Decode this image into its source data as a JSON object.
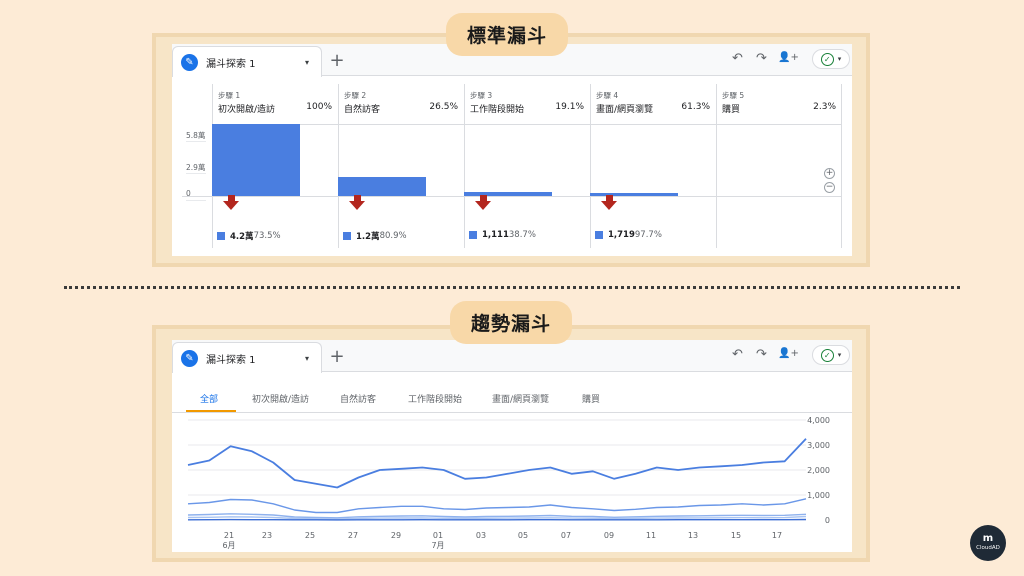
{
  "sections": {
    "standard_title": "標準漏斗",
    "trend_title": "趨勢漏斗"
  },
  "toolbar": {
    "tab_label": "漏斗探索 1",
    "plus": "+",
    "undo": "↶",
    "redo": "↷",
    "share": "👤+",
    "caret": "▾",
    "check": "✓"
  },
  "funnel": {
    "y_axis": [
      "5.8萬",
      "2.9萬",
      "0"
    ],
    "steps": [
      {
        "num": "步驟 1",
        "name": "初次開啟/造訪",
        "pct": "100%"
      },
      {
        "num": "步驟 2",
        "name": "自然訪客",
        "pct": "26.5%"
      },
      {
        "num": "步驟 3",
        "name": "工作階段開始",
        "pct": "19.1%"
      },
      {
        "num": "步驟 4",
        "name": "畫面/網頁瀏覽",
        "pct": "61.3%"
      },
      {
        "num": "步驟 5",
        "name": "購買",
        "pct": "2.3%"
      }
    ],
    "bar_fractions": [
      1.0,
      0.265,
      0.051,
      0.031,
      0.0
    ],
    "dropoffs": [
      {
        "value": "4.2萬",
        "pct": "73.5%"
      },
      {
        "value": "1.2萬",
        "pct": "80.9%"
      },
      {
        "value": "1,111",
        "pct": "38.7%"
      },
      {
        "value": "1,719",
        "pct": "97.7%"
      }
    ],
    "zoom_in": "+",
    "zoom_out": "−",
    "colors": {
      "bar": "#4a7ee0",
      "drop_arrow": "#b3261e"
    }
  },
  "trend": {
    "tabs": [
      "全部",
      "初次開啟/造訪",
      "自然訪客",
      "工作階段開始",
      "畫面/網頁瀏覽",
      "購買"
    ],
    "active_tab": "全部",
    "chart_data": {
      "type": "line",
      "y_ticks": [
        "4,000",
        "3,000",
        "2,000",
        "1,000",
        "0"
      ],
      "ylim": [
        0,
        4000
      ],
      "x_ticks": [
        {
          "day": "21",
          "month": "6月"
        },
        {
          "day": "23",
          "month": ""
        },
        {
          "day": "25",
          "month": ""
        },
        {
          "day": "27",
          "month": ""
        },
        {
          "day": "29",
          "month": ""
        },
        {
          "day": "01",
          "month": "7月"
        },
        {
          "day": "03",
          "month": ""
        },
        {
          "day": "05",
          "month": ""
        },
        {
          "day": "07",
          "month": ""
        },
        {
          "day": "09",
          "month": ""
        },
        {
          "day": "11",
          "month": ""
        },
        {
          "day": "13",
          "month": ""
        },
        {
          "day": "15",
          "month": ""
        },
        {
          "day": "17",
          "month": ""
        }
      ],
      "series": [
        {
          "values": [
            2200,
            2380,
            2950,
            2750,
            2300,
            1600,
            1450,
            1300,
            1700,
            2000,
            2050,
            2100,
            2000,
            1650,
            1700,
            1850,
            2000,
            2100,
            1850,
            1950,
            1650,
            1850,
            2100,
            2000,
            2100,
            2150,
            2200,
            2300,
            2350,
            3250
          ],
          "color": "#4a7ee0"
        },
        {
          "values": [
            650,
            700,
            820,
            800,
            650,
            400,
            300,
            300,
            450,
            500,
            550,
            550,
            450,
            420,
            480,
            500,
            520,
            600,
            500,
            450,
            380,
            430,
            500,
            520,
            580,
            600,
            650,
            600,
            650,
            850
          ],
          "color": "#6a97e8"
        },
        {
          "values": [
            200,
            220,
            250,
            230,
            200,
            120,
            100,
            90,
            130,
            150,
            160,
            170,
            140,
            120,
            140,
            150,
            160,
            180,
            150,
            140,
            110,
            130,
            150,
            160,
            170,
            180,
            190,
            180,
            190,
            230
          ],
          "color": "#8fb2ee"
        },
        {
          "values": [
            100,
            110,
            130,
            120,
            100,
            60,
            50,
            45,
            65,
            75,
            80,
            85,
            70,
            60,
            70,
            75,
            80,
            90,
            75,
            70,
            55,
            65,
            75,
            80,
            85,
            90,
            95,
            90,
            95,
            140
          ],
          "color": "#a9c4f2"
        },
        {
          "values": [
            10,
            12,
            15,
            14,
            12,
            8,
            6,
            5,
            8,
            9,
            10,
            11,
            9,
            8,
            9,
            10,
            11,
            12,
            10,
            9,
            7,
            8,
            10,
            11,
            12,
            13,
            14,
            13,
            14,
            20
          ],
          "color": "#3d6fd6"
        }
      ]
    }
  },
  "logo": {
    "mark": "m",
    "text": "CloudAD"
  }
}
